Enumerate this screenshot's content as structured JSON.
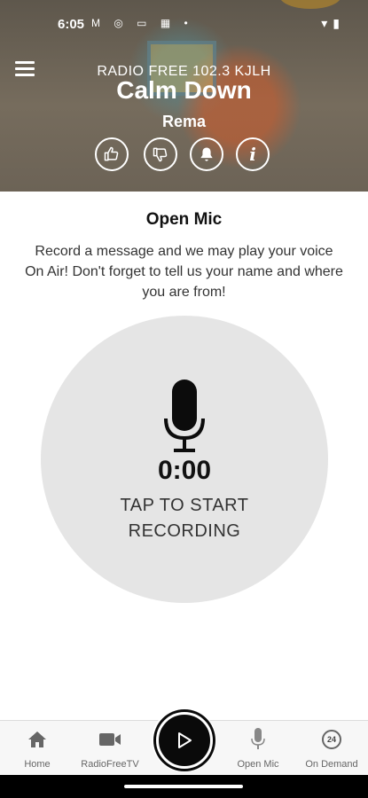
{
  "status_bar": {
    "time": "6:05",
    "icons": [
      "gmail-icon",
      "notification-icon",
      "news-icon",
      "app-icon",
      "dot-icon"
    ],
    "right_icons": [
      "wifi-icon",
      "battery-icon"
    ]
  },
  "header": {
    "station": "RADIO FREE 102.3 KJLH",
    "song": "Calm Down",
    "artist": "Rema",
    "actions": [
      "thumbs-up-icon",
      "thumbs-down-icon",
      "alert-icon",
      "info-icon"
    ],
    "info_glyph": "i"
  },
  "open_mic": {
    "title": "Open Mic",
    "description": "Record a message and we may play your voice On Air! Don't forget to tell us your name and where you are from!",
    "timer": "0:00",
    "prompt": "TAP TO START RECORDING"
  },
  "nav": {
    "items": [
      {
        "label": "Home",
        "icon": "home-icon"
      },
      {
        "label": "RadioFreeTV",
        "icon": "video-camera-icon"
      },
      {
        "label": "Open Mic",
        "icon": "microphone-icon"
      },
      {
        "label": "On Demand",
        "icon": "on-demand-24-icon"
      }
    ],
    "on_demand_badge": "24"
  }
}
